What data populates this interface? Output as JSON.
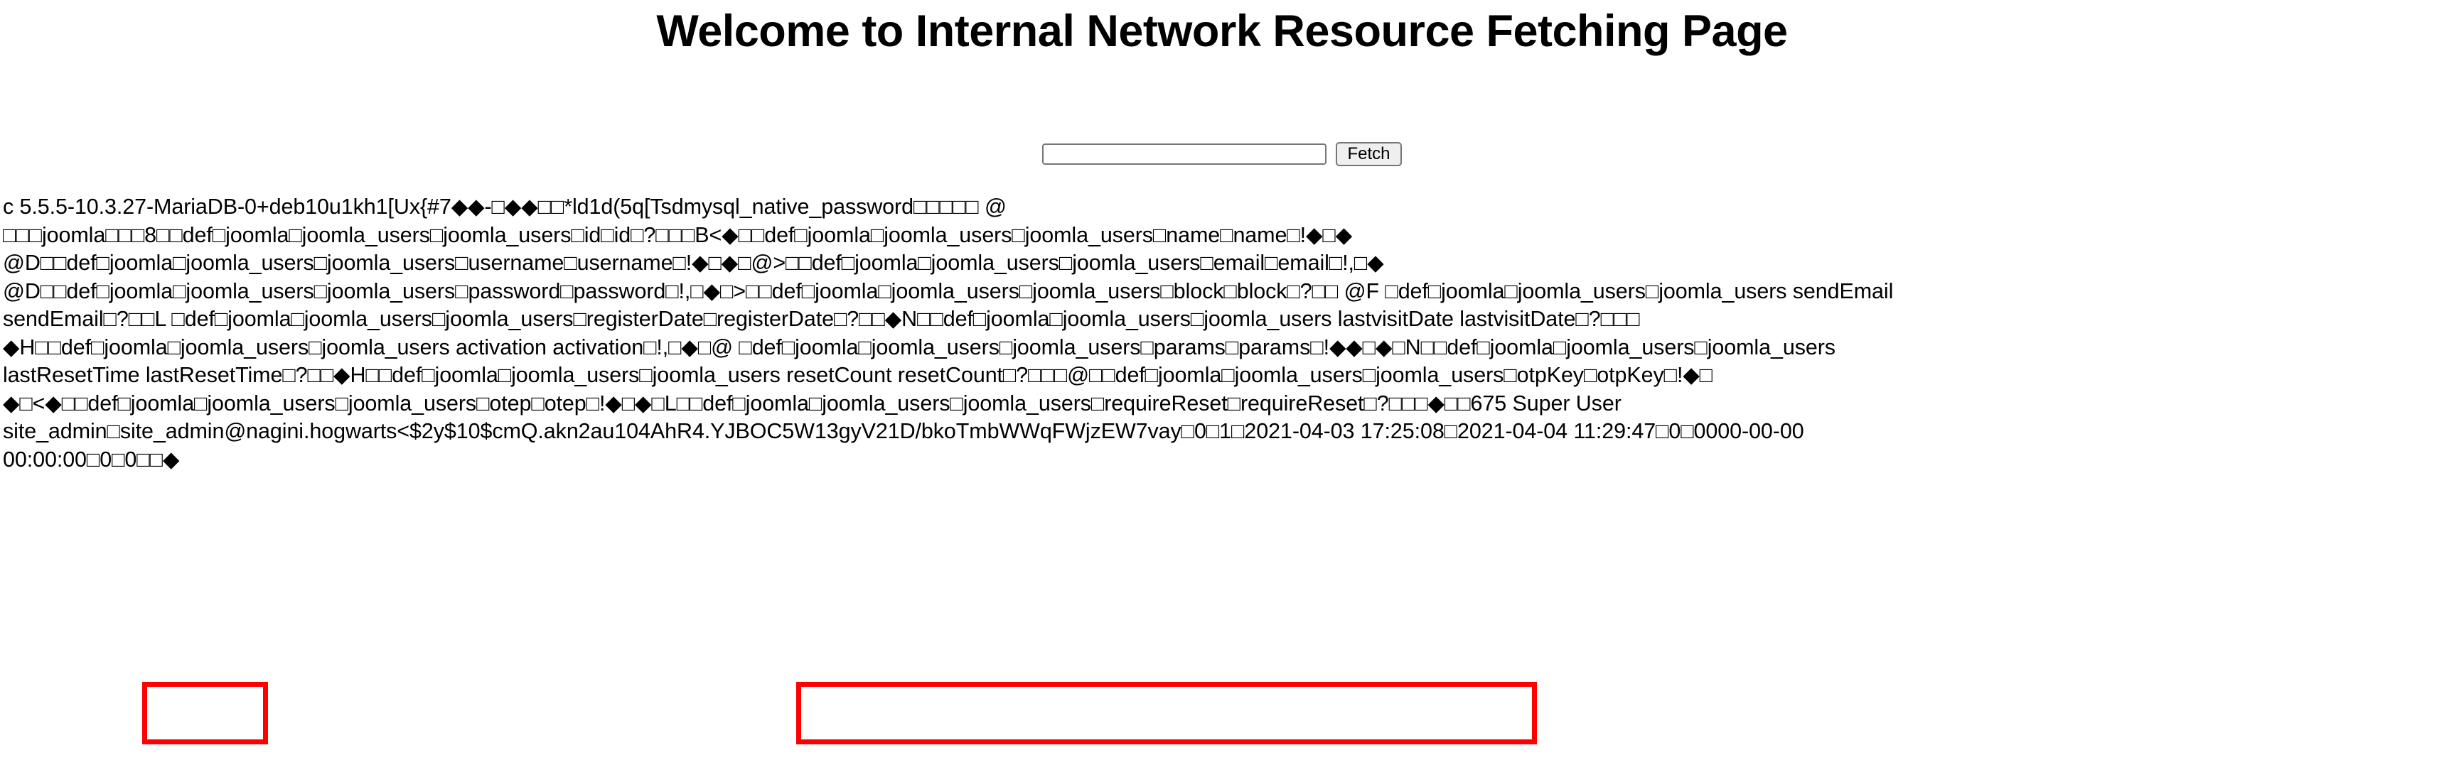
{
  "page": {
    "title": "Welcome to Internal Network Resource Fetching Page"
  },
  "form": {
    "url_input_value": "",
    "url_input_placeholder": "",
    "fetch_button_label": "Fetch"
  },
  "response": {
    "raw_dump": "c 5.5.5-10.3.27-MariaDB-0+deb10u1kh1[Ux{#7◆◆-□◆◆□□*ld1d(5q[Tsdmysql_native_password□□□□□ @\n□□□joomla□□□8□□def□joomla□joomla_users□joomla_users□id□id□?□□□B<◆□□def□joomla□joomla_users□joomla_users□name□name□!◆□◆\n@D□□def□joomla□joomla_users□joomla_users□username□username□!◆□◆□@>□□def□joomla□joomla_users□joomla_users□email□email□!,□◆\n@D□□def□joomla□joomla_users□joomla_users□password□password□!,□◆□>□□def□joomla□joomla_users□joomla_users□block□block□?□□ @F □def□joomla□joomla_users□joomla_users sendEmail\nsendEmail□?□□L □def□joomla□joomla_users□joomla_users□registerDate□registerDate□?□□◆N□□def□joomla□joomla_users□joomla_users lastvisitDate lastvisitDate□?□□□\n◆H□□def□joomla□joomla_users□joomla_users activation activation□!,□◆□@ □def□joomla□joomla_users□joomla_users□params□params□!◆◆□◆□N□□def□joomla□joomla_users□joomla_users\nlastResetTime lastResetTime□?□□◆H□□def□joomla□joomla_users□joomla_users resetCount resetCount□?□□□@□□def□joomla□joomla_users□joomla_users□otpKey□otpKey□!◆□\n◆□<◆□□def□joomla□joomla_users□joomla_users□otep□otep□!◆□◆□L□□def□joomla□joomla_users□joomla_users□requireReset□requireReset□?□□□◆□□675 Super User\nsite_admin□site_admin@nagini.hogwarts<$2y$10$cmQ.akn2au104AhR4.YJBOC5W13gyV21D/bkoTmbWWqFWjzEW7vay□0□1□2021-04-03 17:25:08□2021-04-04 11:29:47□0□0000-00-00\n00:00:00□0□0□□◆"
  },
  "annotations": {
    "box_color": "#ff0000",
    "highlighted_username": "site_admin",
    "highlighted_password_hash": "$2y$10$cmQ.akn2au104AhR4.YJBOC5W13gyV21D/bkoTmbWWqFWjzEW7vay"
  },
  "extracted": {
    "server_banner": "5.5.5-10.3.27-MariaDB-0+deb10u1",
    "auth_plugin": "mysql_native_password",
    "database": "joomla",
    "table": "joomla_users",
    "columns": [
      "id",
      "name",
      "username",
      "email",
      "password",
      "block",
      "sendEmail",
      "registerDate",
      "lastvisitDate",
      "activation",
      "params",
      "lastResetTime",
      "resetCount",
      "otpKey",
      "otep",
      "requireReset"
    ],
    "row": {
      "id": "675",
      "name": "Super User",
      "username": "site_admin",
      "email": "site_admin@nagini.hogwarts",
      "password": "$2y$10$cmQ.akn2au104AhR4.YJBOC5W13gyV21D/bkoTmbWWqFWjzEW7vay",
      "block": "0",
      "sendEmail": "1",
      "registerDate": "2021-04-03 17:25:08",
      "lastvisitDate": "2021-04-04 11:29:47",
      "resetCount": "0",
      "lastResetTime": "0000-00-00 00:00:00",
      "requireReset": "0"
    }
  }
}
